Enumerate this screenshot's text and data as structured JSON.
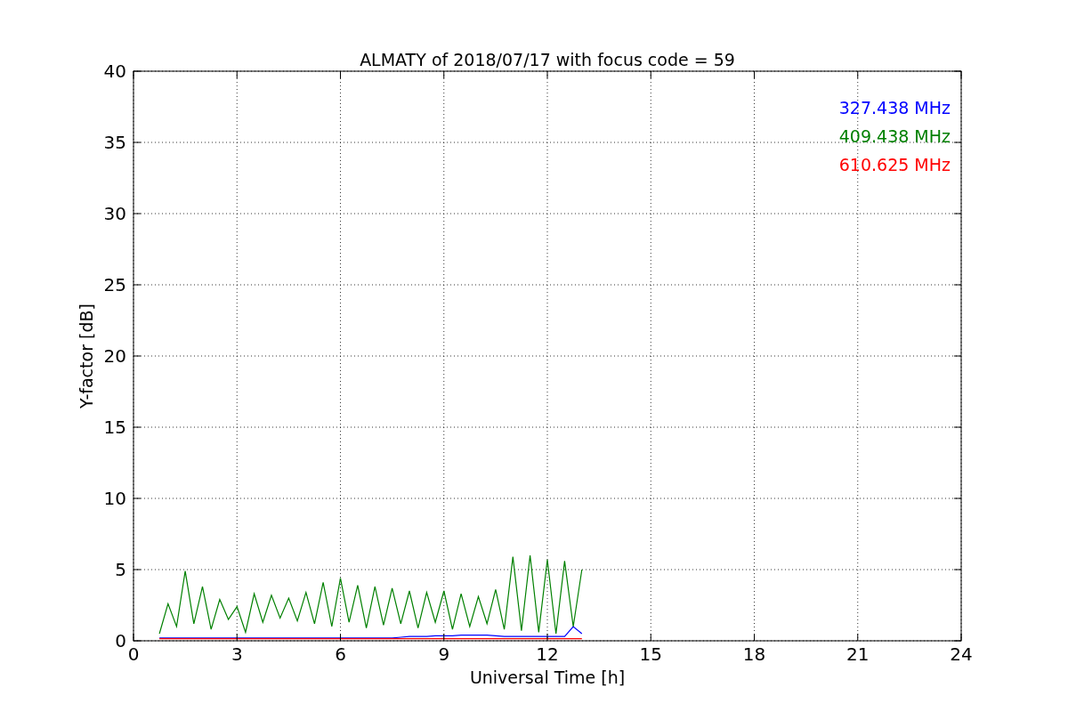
{
  "figure": {
    "chart_data": {
      "type": "line",
      "title": "ALMATY of 2018/07/17 with focus code = 59",
      "xlabel": "Universal Time [h]",
      "ylabel": "Y-factor [dB]",
      "x": [
        0.75,
        1.0,
        1.25,
        1.5,
        1.75,
        2.0,
        2.25,
        2.5,
        2.75,
        3.0,
        3.25,
        3.5,
        3.75,
        4.0,
        4.25,
        4.5,
        4.75,
        5.0,
        5.25,
        5.5,
        5.75,
        6.0,
        6.25,
        6.5,
        6.75,
        7.0,
        7.25,
        7.5,
        7.75,
        8.0,
        8.25,
        8.5,
        8.75,
        9.0,
        9.25,
        9.5,
        9.75,
        10.0,
        10.25,
        10.5,
        10.75,
        11.0,
        11.25,
        11.5,
        11.75,
        12.0,
        12.25,
        12.5,
        12.75,
        13.0
      ],
      "series": [
        {
          "name": "327.438 MHz",
          "color": "#0000ff",
          "values": [
            0.2,
            0.2,
            0.2,
            0.2,
            0.2,
            0.2,
            0.2,
            0.2,
            0.2,
            0.2,
            0.2,
            0.2,
            0.2,
            0.2,
            0.2,
            0.2,
            0.2,
            0.2,
            0.2,
            0.2,
            0.2,
            0.2,
            0.2,
            0.2,
            0.2,
            0.2,
            0.2,
            0.2,
            0.25,
            0.3,
            0.3,
            0.3,
            0.35,
            0.35,
            0.35,
            0.4,
            0.4,
            0.4,
            0.4,
            0.35,
            0.3,
            0.3,
            0.3,
            0.3,
            0.3,
            0.3,
            0.3,
            0.3,
            1.0,
            0.5
          ]
        },
        {
          "name": "409.438 MHz",
          "color": "#008000",
          "values": [
            0.5,
            2.6,
            1.0,
            4.9,
            1.2,
            3.8,
            0.8,
            2.9,
            1.5,
            2.4,
            0.6,
            3.3,
            1.3,
            3.2,
            1.6,
            3.0,
            1.4,
            3.4,
            1.2,
            4.1,
            1.0,
            4.4,
            1.3,
            3.9,
            0.9,
            3.8,
            1.1,
            3.7,
            1.2,
            3.5,
            0.9,
            3.4,
            1.3,
            3.5,
            0.8,
            3.3,
            1.0,
            3.1,
            1.2,
            3.6,
            0.8,
            5.9,
            0.7,
            6.0,
            0.6,
            5.7,
            0.5,
            5.6,
            1.0,
            5.0
          ]
        },
        {
          "name": "610.625 MHz",
          "color": "#ff0000",
          "values": [
            0.15,
            0.15,
            0.15,
            0.15,
            0.15,
            0.15,
            0.15,
            0.15,
            0.15,
            0.15,
            0.15,
            0.15,
            0.15,
            0.15,
            0.15,
            0.15,
            0.15,
            0.15,
            0.15,
            0.15,
            0.15,
            0.15,
            0.15,
            0.15,
            0.15,
            0.15,
            0.15,
            0.15,
            0.15,
            0.15,
            0.15,
            0.15,
            0.15,
            0.15,
            0.15,
            0.15,
            0.15,
            0.15,
            0.15,
            0.15,
            0.15,
            0.15,
            0.15,
            0.15,
            0.15,
            0.15,
            0.15,
            0.15,
            0.15,
            0.15
          ]
        }
      ],
      "grid": true,
      "xlim": [
        0,
        24
      ],
      "ylim": [
        0,
        40
      ],
      "xticks": [
        0,
        3,
        6,
        9,
        12,
        15,
        18,
        21,
        24
      ],
      "yticks": [
        0,
        5,
        10,
        15,
        20,
        25,
        30,
        35,
        40
      ]
    }
  }
}
